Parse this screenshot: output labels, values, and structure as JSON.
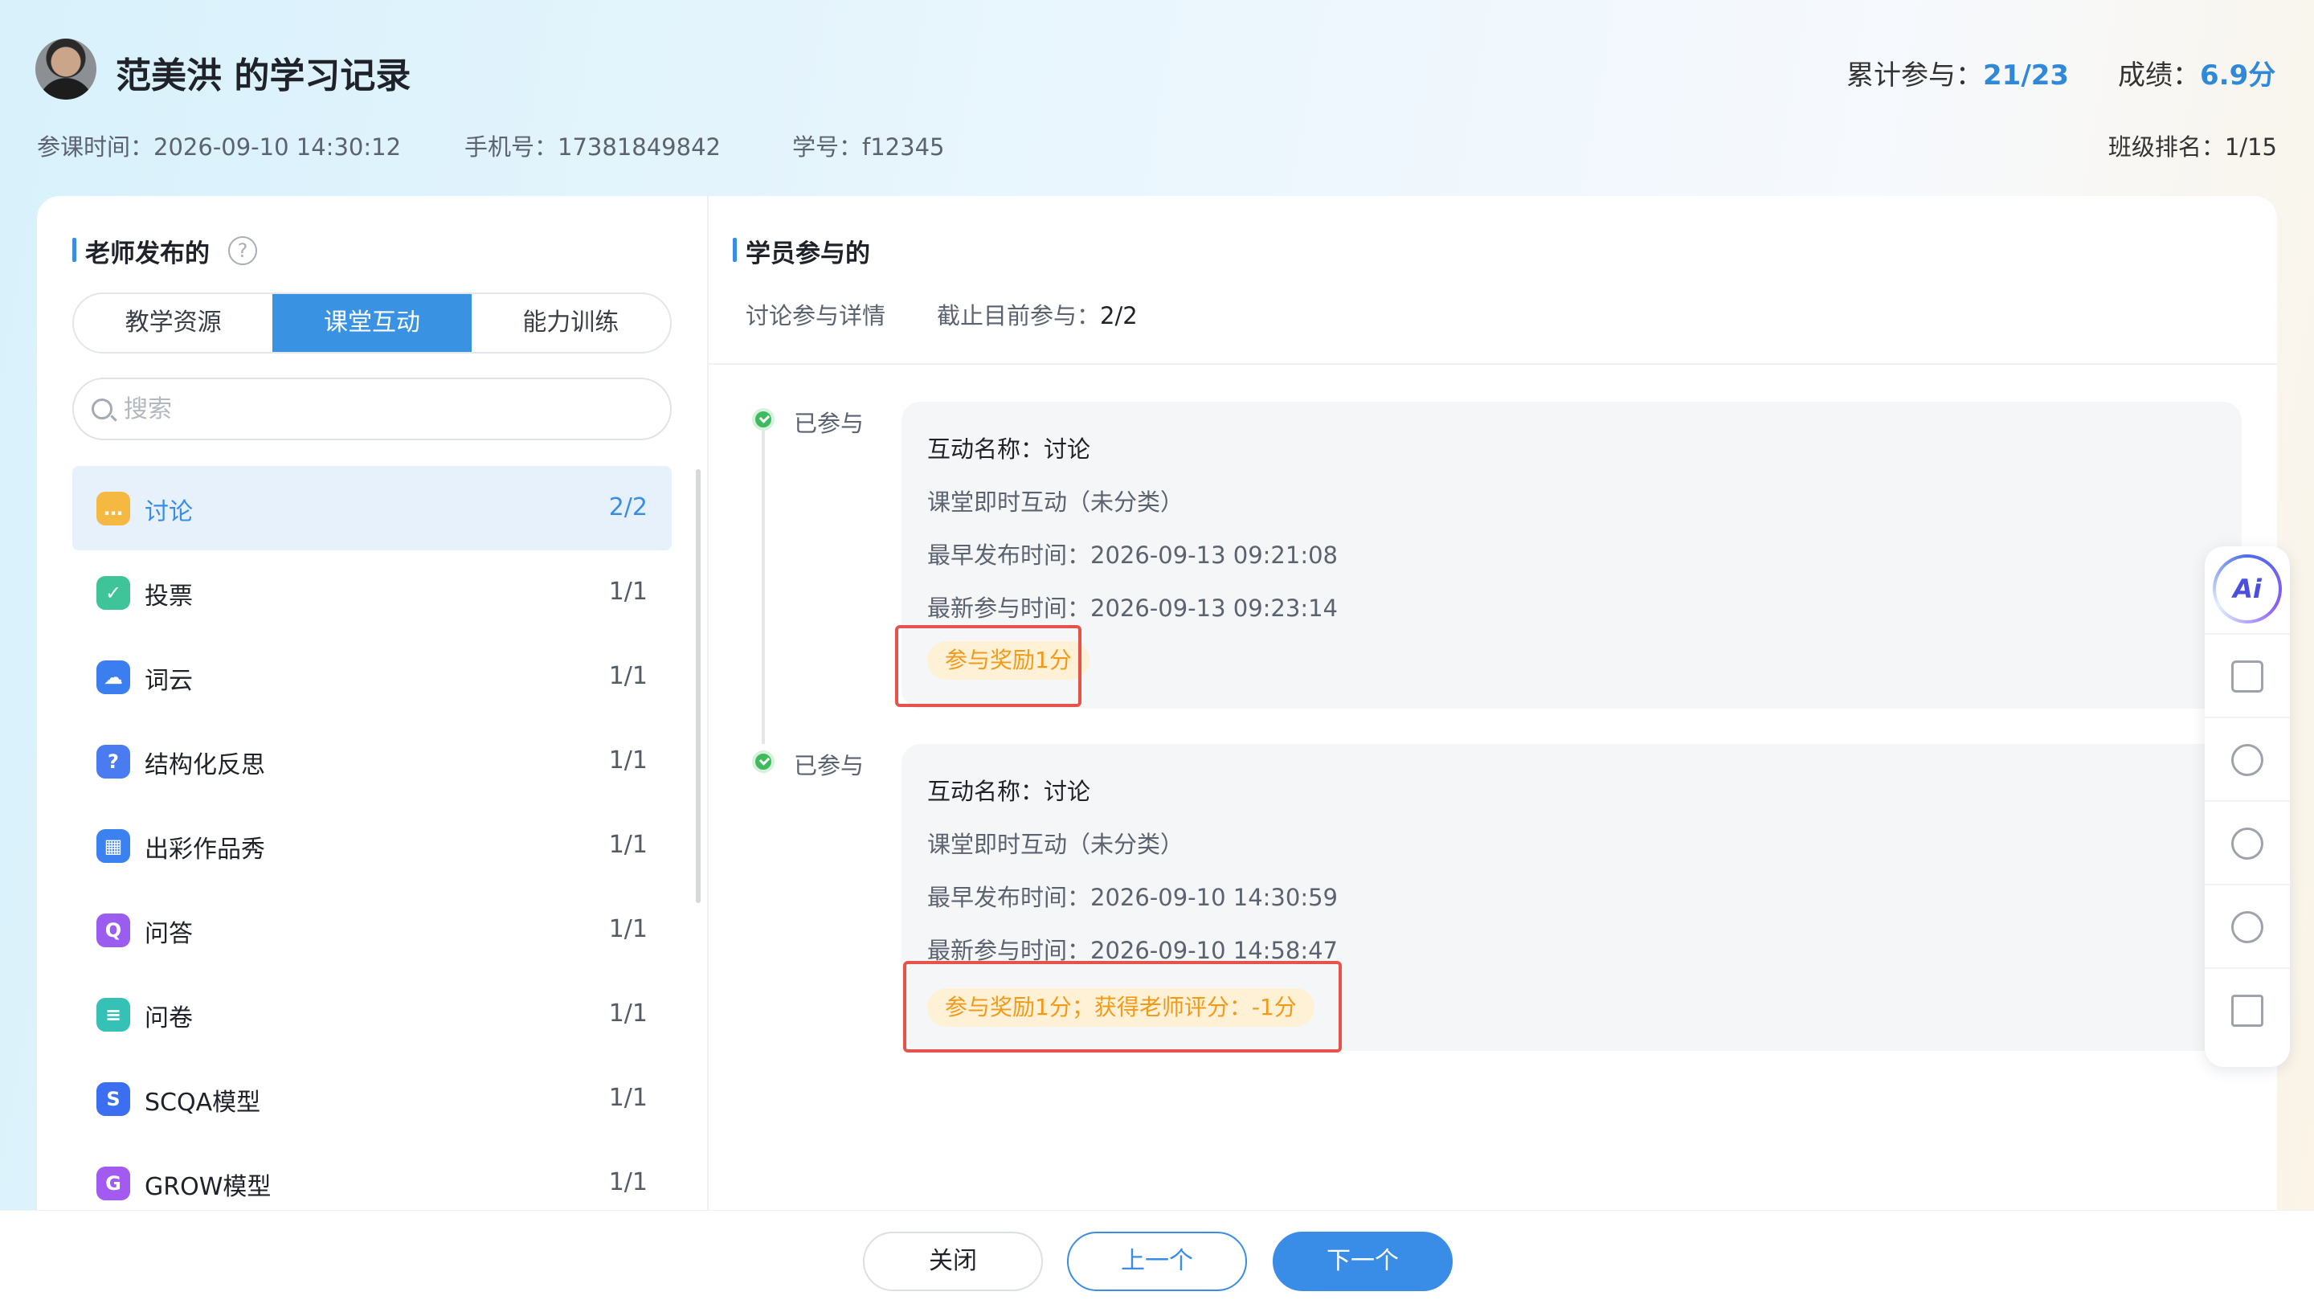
{
  "header": {
    "title": "范美洪 的学习记录",
    "join_time_label": "参课时间：",
    "join_time": "2026-09-10 14:30:12",
    "phone_label": "手机号：",
    "phone": "17381849842",
    "student_id_label": "学号：",
    "student_id": "f12345",
    "participation_label": "累计参与：",
    "participation": "21/23",
    "score_label": "成绩：",
    "score": "6.9分",
    "rank_label": "班级排名：",
    "rank": "1/15"
  },
  "left": {
    "title": "老师发布的",
    "tabs": [
      {
        "label": "教学资源"
      },
      {
        "label": "课堂互动"
      },
      {
        "label": "能力训练"
      }
    ],
    "search_placeholder": "搜索",
    "items": [
      {
        "name": "讨论",
        "count": "2/2",
        "icon": "discussion-icon",
        "color": "#f5b942"
      },
      {
        "name": "投票",
        "count": "1/1",
        "icon": "vote-icon",
        "color": "#3fc49a"
      },
      {
        "name": "词云",
        "count": "1/1",
        "icon": "wordcloud-icon",
        "color": "#3b7ef0"
      },
      {
        "name": "结构化反思",
        "count": "1/1",
        "icon": "reflection-icon",
        "color": "#4b7bf0"
      },
      {
        "name": "出彩作品秀",
        "count": "1/1",
        "icon": "showcase-icon",
        "color": "#3b82f0"
      },
      {
        "name": "问答",
        "count": "1/1",
        "icon": "qa-icon",
        "color": "#9b5cf0"
      },
      {
        "name": "问卷",
        "count": "1/1",
        "icon": "survey-icon",
        "color": "#35c1b6"
      },
      {
        "name": "SCQA模型",
        "count": "1/1",
        "icon": "scqa-icon",
        "color": "#3b6ef0"
      },
      {
        "name": "GROW模型",
        "count": "1/1",
        "icon": "grow-icon",
        "color": "#a25af0"
      }
    ]
  },
  "right": {
    "title": "学员参与的",
    "detail_label": "讨论参与详情",
    "progress_label": "截止目前参与：",
    "progress": "2/2",
    "records": [
      {
        "status": "已参与",
        "name": "互动名称：讨论",
        "category": "课堂即时互动（未分类）",
        "first_publish": "最早发布时间：2026-09-13 09:21:08",
        "last_join": "最新参与时间：2026-09-13 09:23:14",
        "reward": "参与奖励1分"
      },
      {
        "status": "已参与",
        "name": "互动名称：讨论",
        "category": "课堂即时互动（未分类）",
        "first_publish": "最早发布时间：2026-09-10 14:30:59",
        "last_join": "最新参与时间：2026-09-10 14:58:47",
        "reward": "参与奖励1分；获得老师评分：-1分"
      }
    ]
  },
  "toolbar": {
    "ai_label": "Ai"
  },
  "footer": {
    "close": "关闭",
    "prev": "上一个",
    "next": "下一个"
  }
}
